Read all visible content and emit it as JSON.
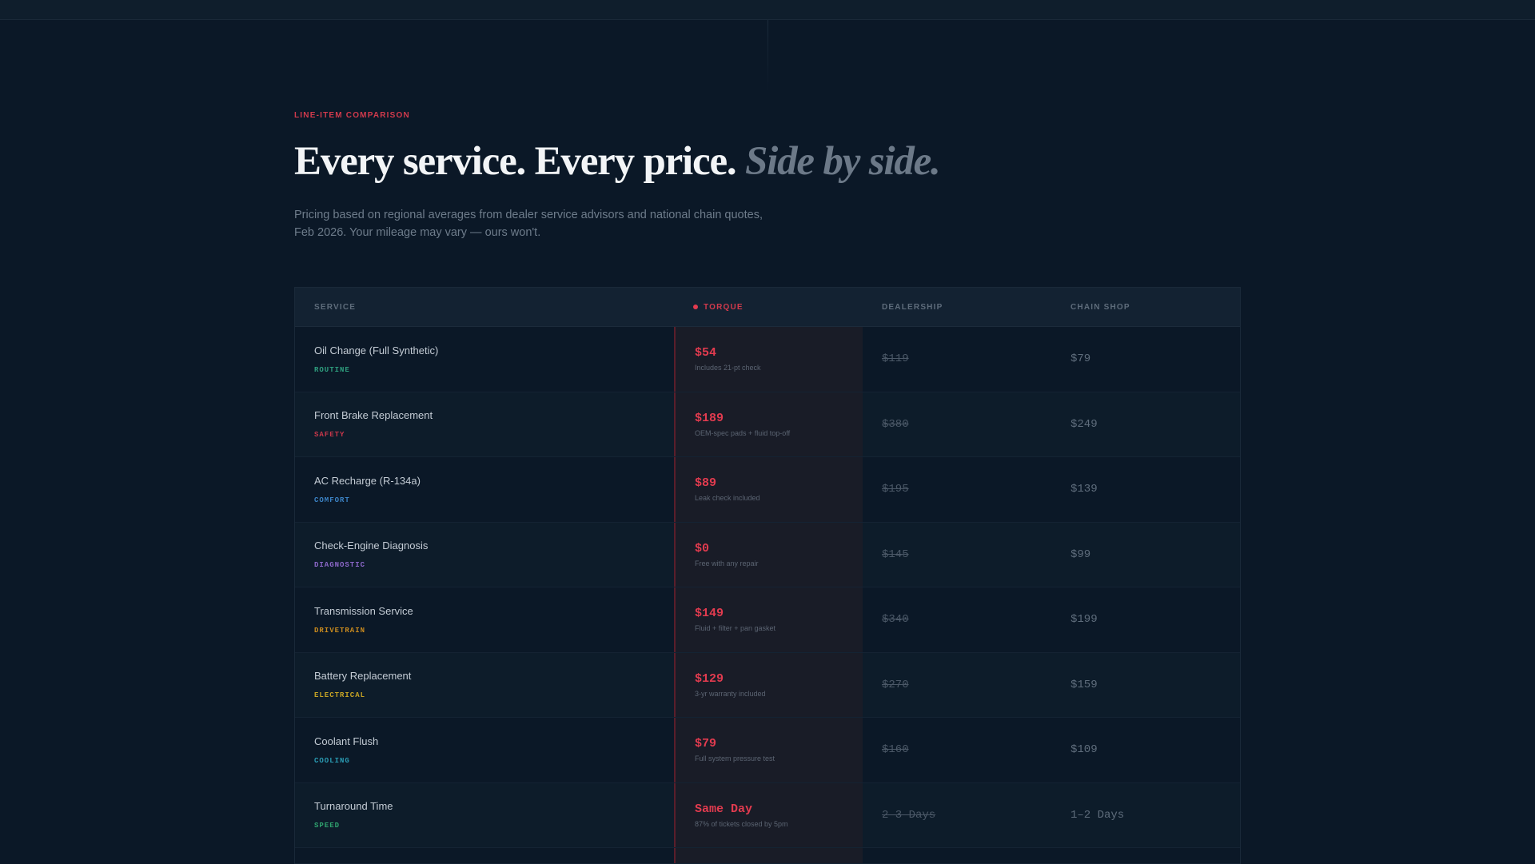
{
  "header": {
    "eyebrow": "LINE-ITEM COMPARISON",
    "headline_main": "Every service. Every price.",
    "headline_accent": "Side by side.",
    "sub_line1": "Pricing based on regional averages from dealer service advisors and national chain quotes,",
    "sub_line2": "Feb 2026. Your mileage may vary — ours won't."
  },
  "table": {
    "columns": {
      "service": "SERVICE",
      "torque": "TORQUE",
      "dealership": "DEALERSHIP",
      "chain": "CHAIN SHOP"
    },
    "rows": [
      {
        "service": "Oil Change (Full Synthetic)",
        "tag": "ROUTINE",
        "tag_color": "#2e9e7e",
        "torque": "$54",
        "note": "Includes 21-pt check",
        "dealership": "$119",
        "chain": "$79"
      },
      {
        "service": "Front Brake Replacement",
        "tag": "SAFETY",
        "tag_color": "#c9374a",
        "torque": "$189",
        "note": "OEM-spec pads + fluid top-off",
        "dealership": "$380",
        "chain": "$249"
      },
      {
        "service": "AC Recharge (R-134a)",
        "tag": "COMFORT",
        "tag_color": "#3b82c4",
        "torque": "$89",
        "note": "Leak check included",
        "dealership": "$195",
        "chain": "$139"
      },
      {
        "service": "Check-Engine Diagnosis",
        "tag": "DIAGNOSTIC",
        "tag_color": "#8b67c8",
        "torque": "$0",
        "note": "Free with any repair",
        "dealership": "$145",
        "chain": "$99"
      },
      {
        "service": "Transmission Service",
        "tag": "DRIVETRAIN",
        "tag_color": "#c98a1e",
        "torque": "$149",
        "note": "Fluid + filter + pan gasket",
        "dealership": "$340",
        "chain": "$199"
      },
      {
        "service": "Battery Replacement",
        "tag": "ELECTRICAL",
        "tag_color": "#c7a424",
        "torque": "$129",
        "note": "3-yr warranty included",
        "dealership": "$270",
        "chain": "$159"
      },
      {
        "service": "Coolant Flush",
        "tag": "COOLING",
        "tag_color": "#2a9bb3",
        "torque": "$79",
        "note": "Full system pressure test",
        "dealership": "$160",
        "chain": "$109"
      },
      {
        "service": "Turnaround Time",
        "tag": "SPEED",
        "tag_color": "#2fa26e",
        "torque": "Same Day",
        "note": "87% of tickets closed by 5pm",
        "dealership": "2–3 Days",
        "chain": "1–2 Days"
      }
    ]
  }
}
